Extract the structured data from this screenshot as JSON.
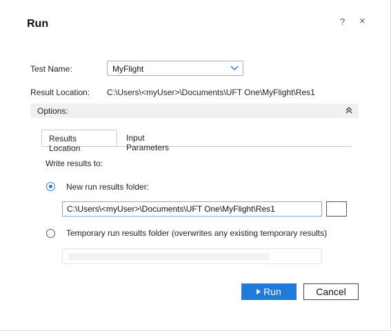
{
  "dialog": {
    "title": "Run",
    "help_icon": "?",
    "close_icon": "×"
  },
  "form": {
    "test_name_label": "Test Name:",
    "test_name_value": "MyFlight",
    "result_location_label": "Result Location:",
    "result_location_value": "C:\\Users\\<myUser>\\Documents\\UFT One\\MyFlight\\Res1"
  },
  "options": {
    "label": "Options:"
  },
  "tabs": [
    {
      "label": "Results Location",
      "active": true
    },
    {
      "label": "Input Parameters",
      "active": false
    }
  ],
  "results_location": {
    "write_results_label": "Write results to:",
    "new_folder_label": "New run results folder:",
    "new_folder_checked": true,
    "new_folder_path": "C:\\Users\\<myUser>\\Documents\\UFT One\\MyFlight\\Res1",
    "temp_folder_label": "Temporary run results folder (overwrites any existing temporary results)",
    "temp_folder_checked": false
  },
  "buttons": {
    "run": "Run",
    "cancel": "Cancel"
  },
  "colors": {
    "accent": "#1f7ad9",
    "options_bar": "#f0f0f0"
  },
  "icons": {
    "help": "help-icon",
    "close": "close-icon",
    "dropdown": "chevron-down-icon",
    "collapse": "double-chevron-up-icon",
    "run": "play-icon"
  }
}
